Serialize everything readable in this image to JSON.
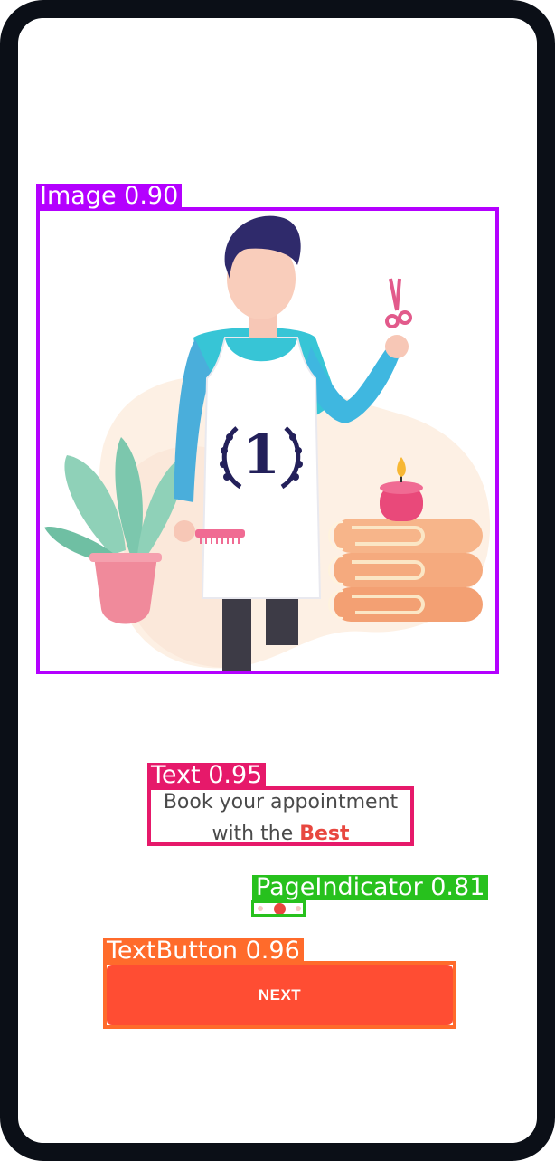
{
  "onboarding": {
    "line1": "Book your appointment",
    "line2_prefix": "with the ",
    "line2_accent": "Best",
    "page_indicator": {
      "count": 3,
      "active_index": 1
    },
    "next_label": "NEXT"
  },
  "detections": [
    {
      "label": "Image 0.90"
    },
    {
      "label": "Text 0.95"
    },
    {
      "label": "PageIndicator 0.81"
    },
    {
      "label": "TextButton 0.96"
    }
  ],
  "illustration": {
    "apron_badge": "1",
    "icons": [
      "barber-illustration",
      "plant-icon",
      "scissors-icon",
      "comb-icon",
      "candle-icon",
      "towel-stack-icon"
    ]
  },
  "colors": {
    "accent": "#ff4d33",
    "accent_text": "#e8473f",
    "frame": "#0b0f17",
    "image_box": "#b400ff",
    "text_box": "#e6196a",
    "indicator_box": "#27c11d",
    "button_box": "#ff6b2b"
  }
}
